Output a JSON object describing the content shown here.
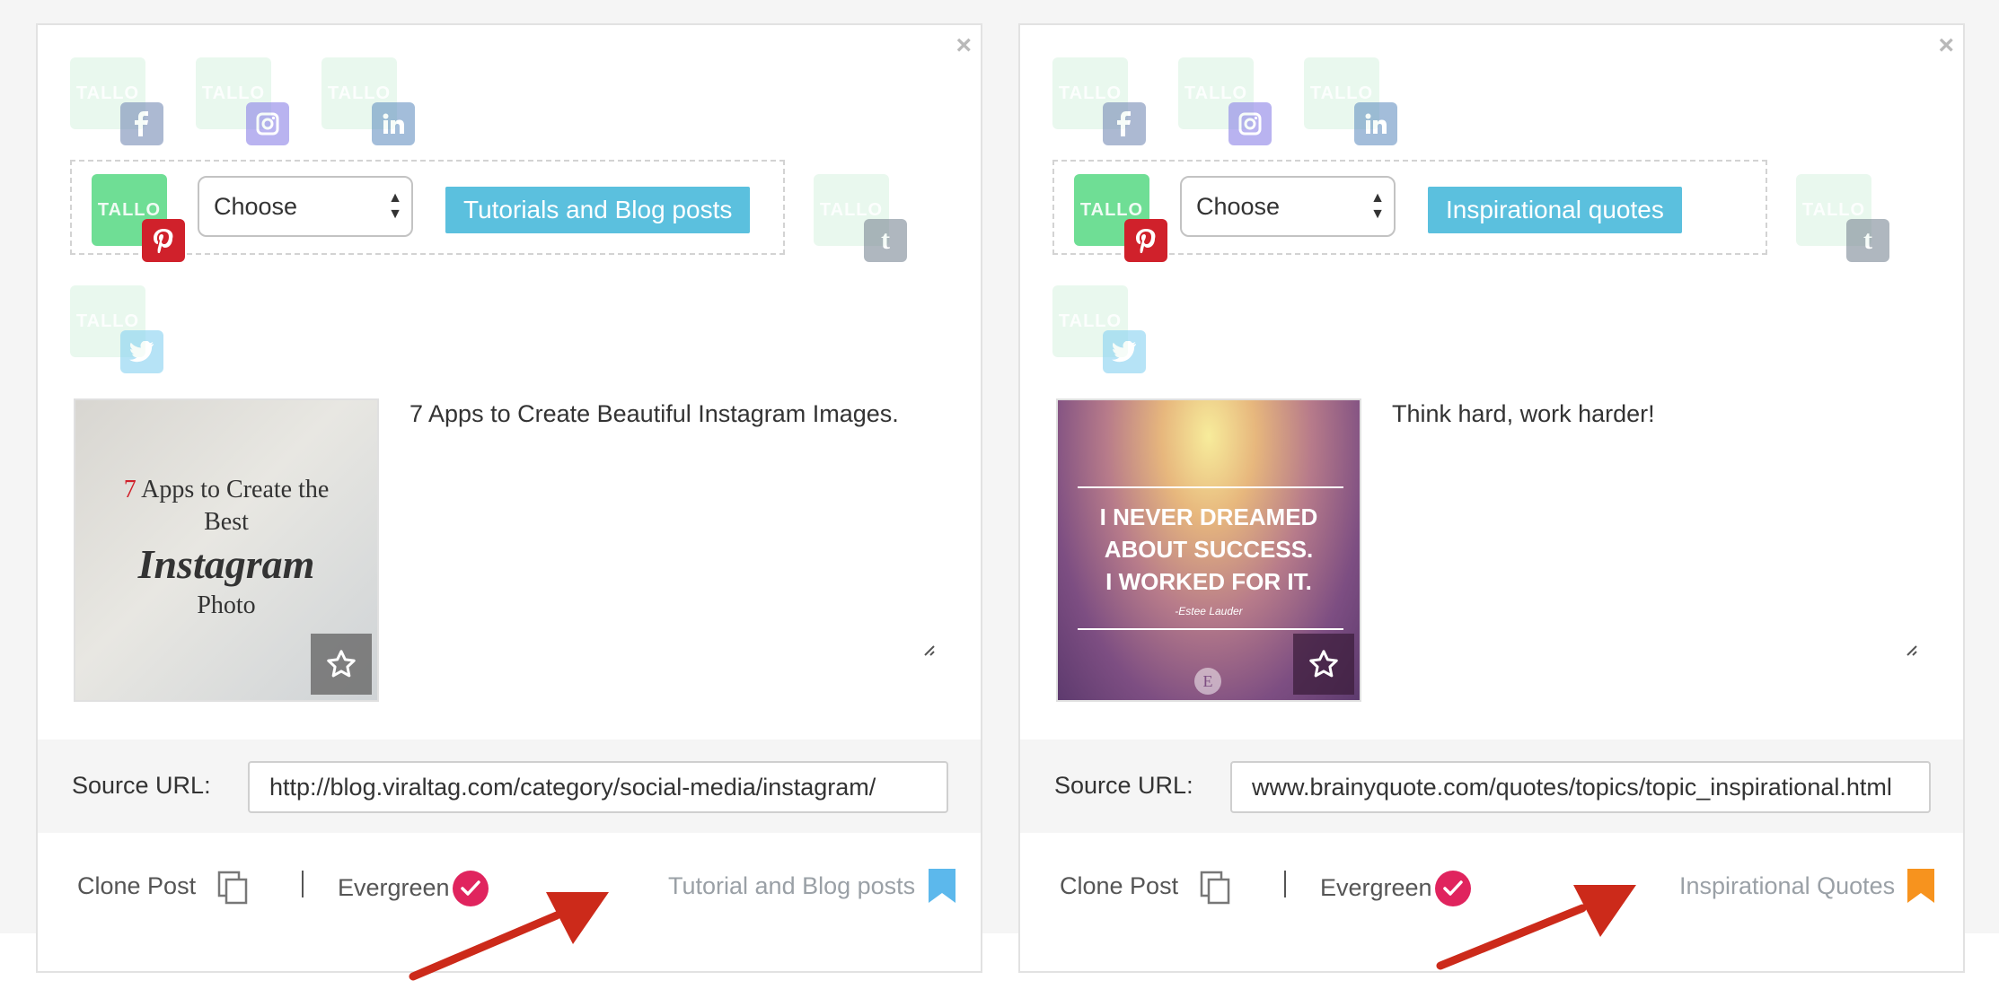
{
  "colors": {
    "tallo_active": "#6fde95",
    "category_button": "#5bc0de",
    "pinterest": "#d0212b",
    "evergreen_check": "#e0245e",
    "bookmark_blue": "#5cb8ec",
    "bookmark_orange": "#f7931e",
    "arrow_red": "#cc2a1a"
  },
  "cards": [
    {
      "account_logo_text": "TALLO",
      "accounts_row1": [
        "facebook",
        "instagram",
        "linkedin"
      ],
      "accounts_row3": [
        "twitter"
      ],
      "selected_account": "pinterest",
      "side_account": "tumblr",
      "select_value": "Choose",
      "category_button": "Tutorials and Blog posts",
      "caption": "7 Apps to Create Beautiful Instagram Images.",
      "image": {
        "line1_number": "7",
        "line1_rest": " Apps to Create the",
        "line2": "Best",
        "line3": "Instagram",
        "line4": "Photo"
      },
      "source_label": "Source URL:",
      "source_url": "http://blog.viraltag.com/category/social-media/instagram/",
      "clone_label": "Clone Post",
      "evergreen_label": "Evergreen",
      "category_tag": "Tutorial and Blog posts",
      "bookmark_color": "#5cb8ec"
    },
    {
      "account_logo_text": "TALLO",
      "accounts_row1": [
        "facebook",
        "instagram",
        "linkedin"
      ],
      "accounts_row3": [
        "twitter"
      ],
      "selected_account": "pinterest",
      "side_account": "tumblr",
      "select_value": "Choose",
      "category_button": "Inspirational quotes",
      "caption": "Think hard, work harder!",
      "image": {
        "quote_line1": "I NEVER DREAMED",
        "quote_line2": "ABOUT SUCCESS.",
        "quote_line3": "I WORKED FOR IT.",
        "author": "-Estee Lauder",
        "logo": "E"
      },
      "source_label": "Source URL:",
      "source_url": "www.brainyquote.com/quotes/topics/topic_inspirational.html",
      "clone_label": "Clone Post",
      "evergreen_label": "Evergreen",
      "category_tag": "Inspirational Quotes",
      "bookmark_color": "#f7931e"
    }
  ]
}
